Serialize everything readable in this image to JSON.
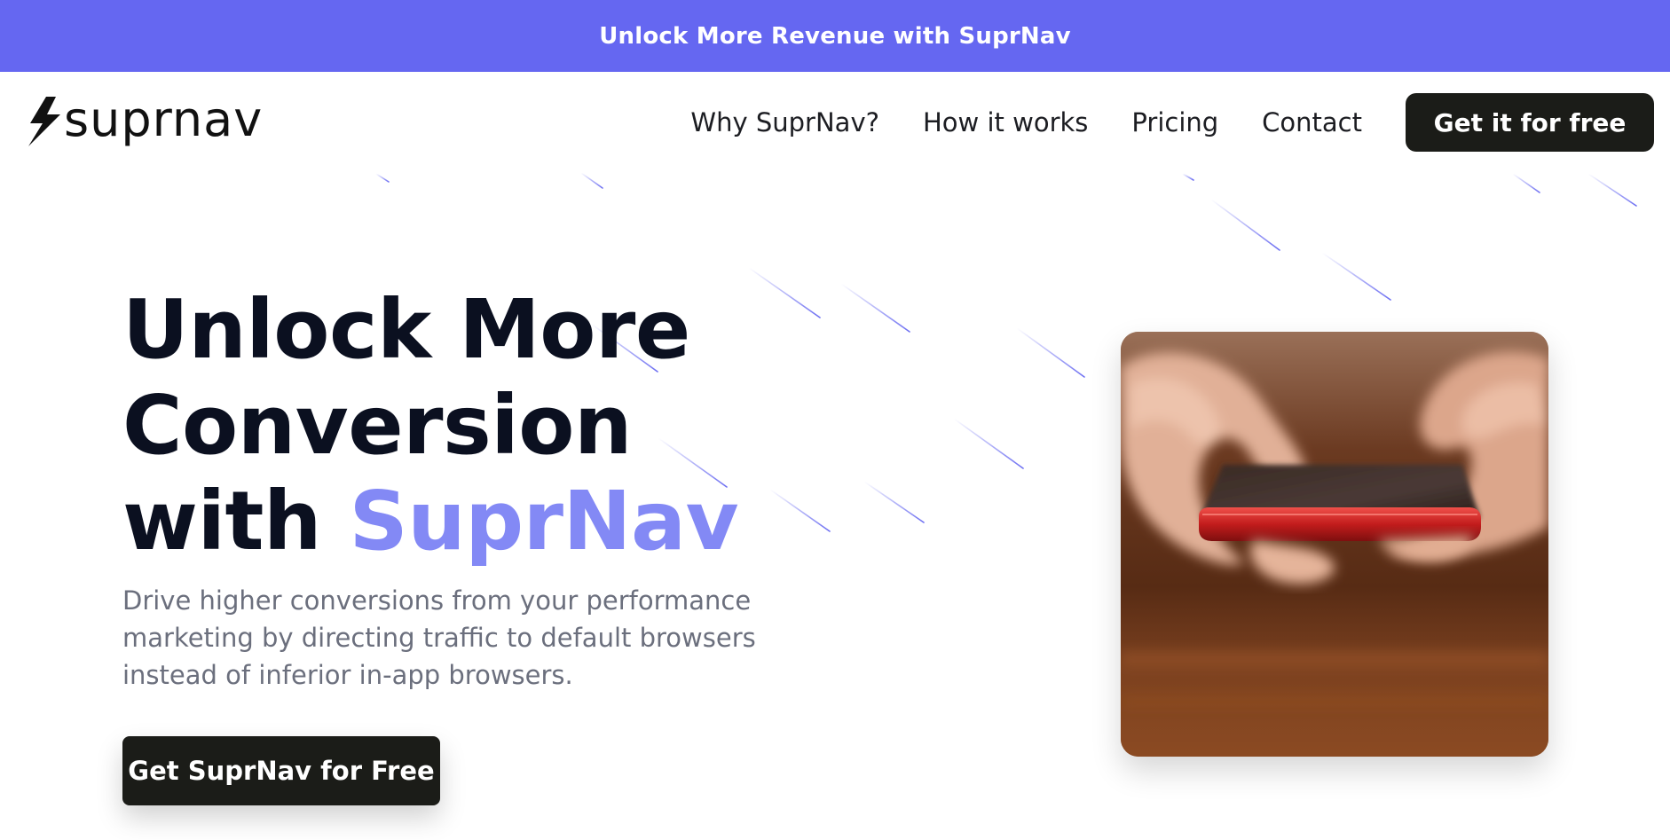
{
  "announcement": {
    "text": "Unlock More Revenue with SuprNav"
  },
  "header": {
    "logo_text": "suprnav",
    "nav": [
      {
        "label": "Why SuprNav?"
      },
      {
        "label": "How it works"
      },
      {
        "label": "Pricing"
      },
      {
        "label": "Contact"
      }
    ],
    "cta_label": "Get it for free"
  },
  "hero": {
    "title_line1": "Unlock More",
    "title_line2": "Conversion",
    "title_line3_prefix": "with ",
    "title_line3_accent": "SuprNav",
    "subtitle": "Drive higher conversions from your performance marketing by directing traffic to default browsers instead of inferior in-app browsers.",
    "cta_label": "Get SuprNav for Free",
    "image_icon": "phone-in-hands-photo"
  },
  "colors": {
    "announcement_bg": "#6567f1",
    "accent_text": "#8389f5",
    "button_bg": "#1b1c18",
    "meteor_line": "#6567f1"
  }
}
